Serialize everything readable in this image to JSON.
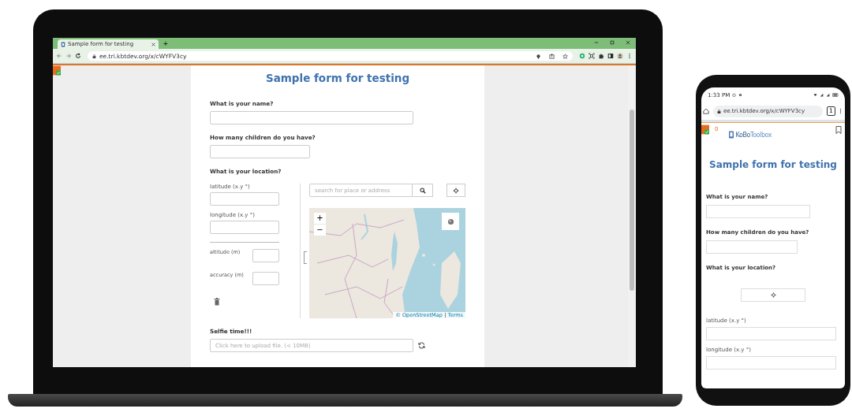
{
  "laptop": {
    "browser": {
      "tab_title": "Sample form for testing",
      "new_tab_button": "+",
      "url": "ee.tri.kbtdev.org/x/cWYFV3cy"
    },
    "form": {
      "title": "Sample form for testing",
      "questions": [
        {
          "kind": "text",
          "label": "What is your name?"
        },
        {
          "kind": "number",
          "label": "How many children do you have?"
        },
        {
          "kind": "geopoint",
          "label": "What is your location?",
          "latitude_label": "latitude (x.y °)",
          "longitude_label": "longitude (x.y °)",
          "altitude_label": "altitude (m)",
          "accuracy_label": "accuracy (m)",
          "search_placeholder": "search for place or address",
          "zoom_in": "+",
          "zoom_out": "−",
          "attribution": "© OpenStreetMap",
          "terms_link": "Terms"
        },
        {
          "kind": "file",
          "label": "Selfie time!!!",
          "placeholder": "Click here to upload file. (< 10MB)"
        }
      ]
    }
  },
  "phone": {
    "status_time": "1:33 PM",
    "url": "ee.tri.kbtdev.org/x/cWYFV3cy",
    "tab_count": "1",
    "counter": "0",
    "logo_primary": "KoBo",
    "logo_secondary": "Toolbox",
    "form": {
      "title": "Sample form for testing",
      "questions": [
        {
          "kind": "text",
          "label": "What is your name?"
        },
        {
          "kind": "number",
          "label": "How many children do you have?"
        },
        {
          "kind": "geopoint",
          "label": "What is your location?",
          "latitude_label": "latitude (x.y °)",
          "longitude_label": "longitude (x.y °)"
        }
      ]
    }
  }
}
